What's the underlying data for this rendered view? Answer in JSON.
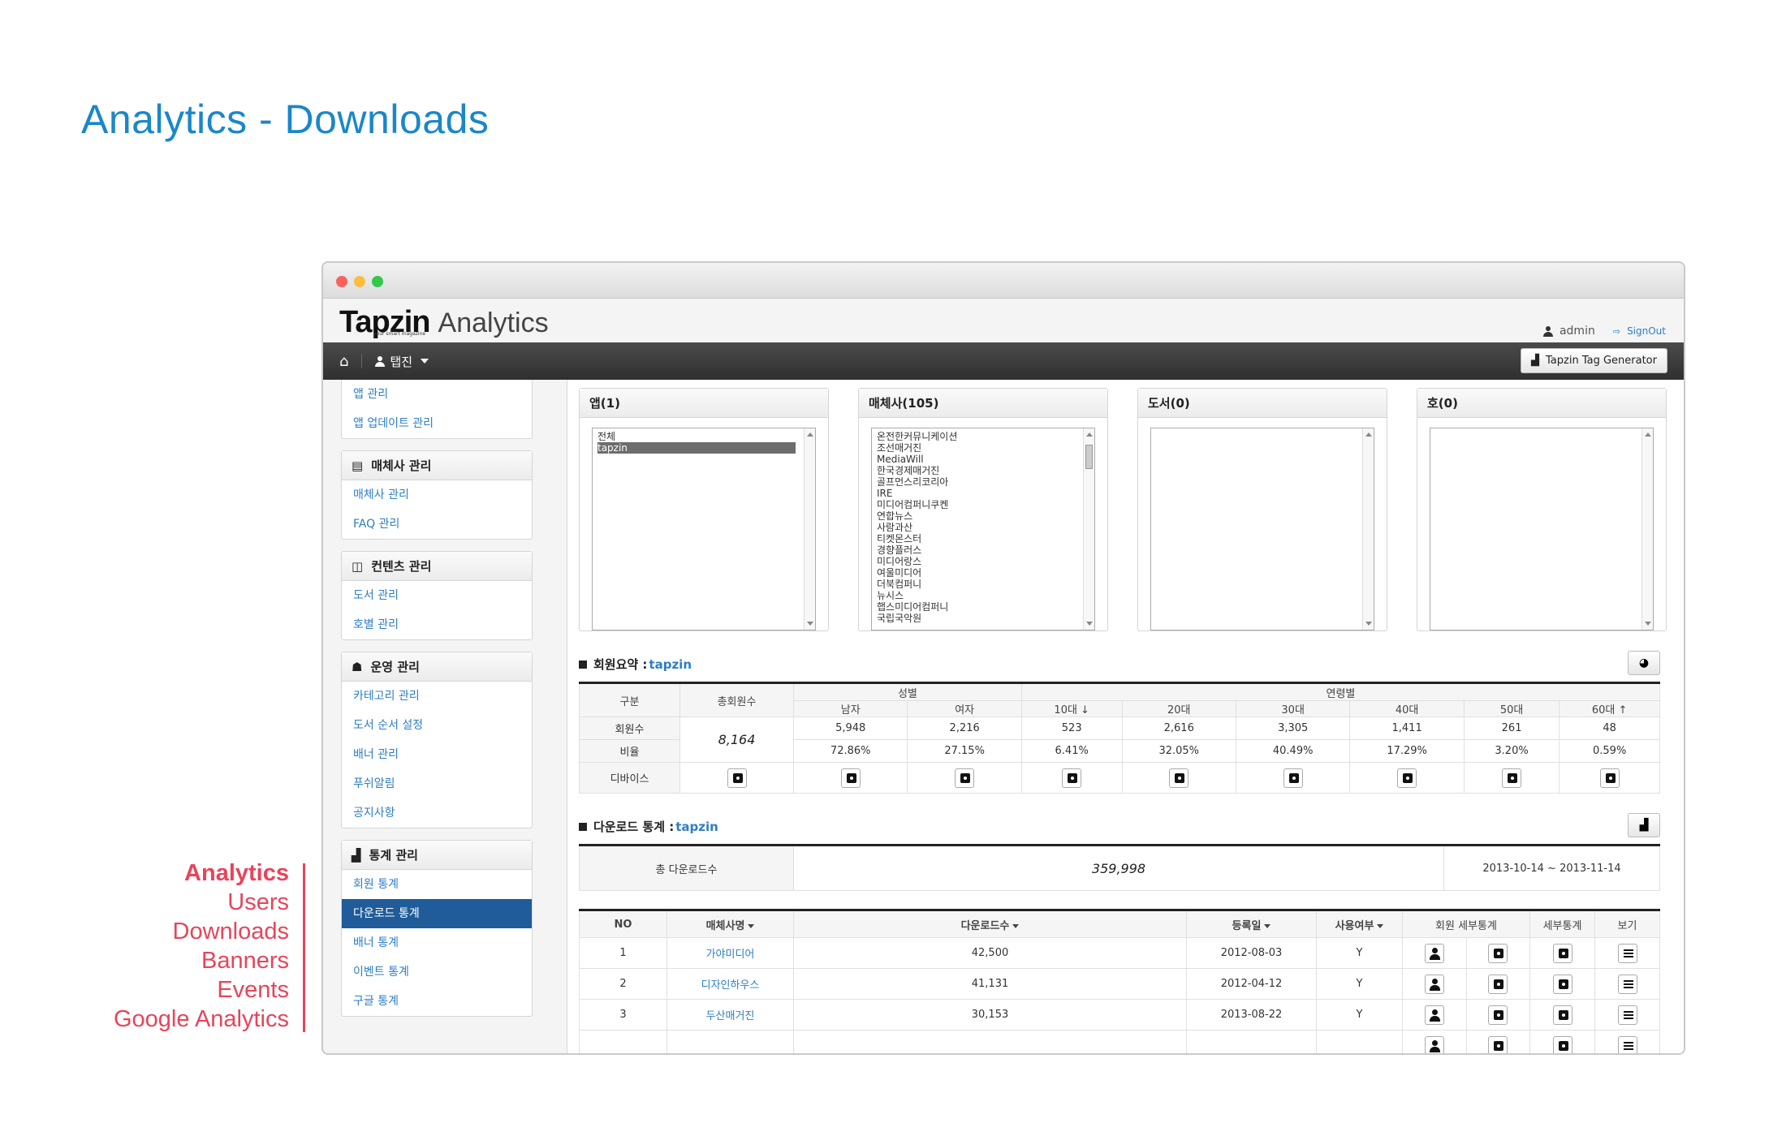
{
  "slide": {
    "title": "Analytics - Downloads",
    "menu": [
      "Analytics",
      "Users",
      "Downloads",
      "Banners",
      "Events",
      "Google Analytics"
    ]
  },
  "header": {
    "logo_main": "Tapzin",
    "logo_sub": "Analytics",
    "logo_tag": "your smart magazine",
    "user": "admin",
    "signout": "SignOut"
  },
  "navbar": {
    "home_icon": "home-icon",
    "app_menu": "탭진",
    "tag_generator": "Tapzin Tag Generator"
  },
  "sidebar": {
    "top_links": [
      "앱 관리",
      "앱 업데이트 관리"
    ],
    "groups": [
      {
        "title": "매체사 관리",
        "icon": "book-icon",
        "links": [
          "매체사 관리",
          "FAQ 관리"
        ]
      },
      {
        "title": "컨텐츠 관리",
        "icon": "inbox-icon",
        "links": [
          "도서 관리",
          "호별 관리"
        ]
      },
      {
        "title": "운영 관리",
        "icon": "group-icon",
        "links": [
          "카테고리 관리",
          "도서 순서 설정",
          "배너 관리",
          "푸쉬알림",
          "공지사항"
        ]
      },
      {
        "title": "통계 관리",
        "icon": "chart-icon",
        "links": [
          "회원 통계",
          "다운로드 통계",
          "배너 통계",
          "이벤트 통계",
          "구글 통계"
        ],
        "active_index": 1
      }
    ]
  },
  "pickers": [
    {
      "title": "앱(1)",
      "options": [
        "전체",
        "tapzin"
      ],
      "selected_index": 1,
      "scroll": false
    },
    {
      "title": "매체사(105)",
      "options": [
        "온전한커뮤니케이션",
        "조선매거진",
        "MediaWill",
        "한국경제매거진",
        "골프먼스리코리아",
        "IRE",
        "미디어컴퍼니쿠켄",
        "연합뉴스",
        "사람과산",
        "티켓몬스터",
        "경향플러스",
        "미디어랑스",
        "여울미디어",
        "더북컴퍼니",
        "뉴시스",
        "햅스미디어컴퍼니",
        "국립국악원"
      ],
      "selected_index": -1,
      "scroll": true
    },
    {
      "title": "도서(0)",
      "options": [],
      "selected_index": -1,
      "scroll": false
    },
    {
      "title": "호(0)",
      "options": [],
      "selected_index": -1,
      "scroll": false
    }
  ],
  "member_summary": {
    "label": "회원요약 : ",
    "app": "tapzin",
    "headers": {
      "category": "구분",
      "total": "총회원수",
      "gender": "성별",
      "age": "연령별",
      "male": "남자",
      "female": "여자",
      "ages": [
        "10대 ↓",
        "20대",
        "30대",
        "40대",
        "50대",
        "60대 ↑"
      ]
    },
    "rows": {
      "members_label": "회원수",
      "ratio_label": "비율",
      "device_label": "디바이스",
      "total": "8,164",
      "members": [
        "5,948",
        "2,216",
        "523",
        "2,616",
        "3,305",
        "1,411",
        "261",
        "48"
      ],
      "ratios": [
        "72.86%",
        "27.15%",
        "6.41%",
        "32.05%",
        "40.49%",
        "17.29%",
        "3.20%",
        "0.59%"
      ]
    }
  },
  "download_stats": {
    "label": "다운로드 통계 : ",
    "app": "tapzin",
    "total_label": "총 다운로드수",
    "total": "359,998",
    "period": "2013-10-14 ~ 2013-11-14",
    "columns": [
      "NO",
      "매체사명",
      "다운로드수",
      "등록일",
      "사용여부",
      "회원 세부통계",
      "세부통계",
      "보기"
    ],
    "rows": [
      {
        "no": "1",
        "publisher": "가야미디어",
        "downloads": "42,500",
        "date": "2012-08-03",
        "use": "Y"
      },
      {
        "no": "2",
        "publisher": "디자인하우스",
        "downloads": "41,131",
        "date": "2012-04-12",
        "use": "Y"
      },
      {
        "no": "3",
        "publisher": "두산매거진",
        "downloads": "30,153",
        "date": "2013-08-22",
        "use": "Y"
      }
    ]
  }
}
